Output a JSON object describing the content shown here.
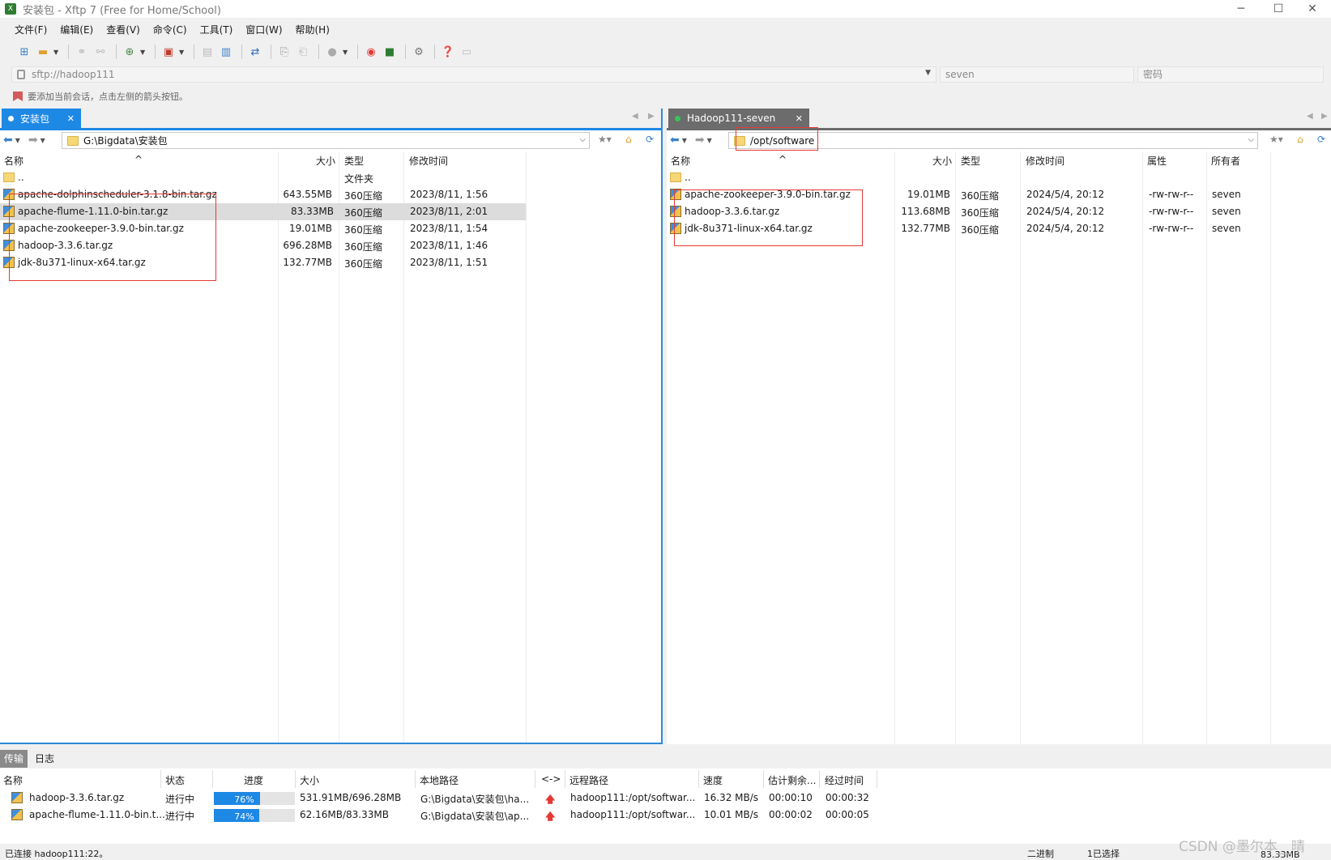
{
  "window": {
    "title": "安装包 - Xftp 7 (Free for Home/School)",
    "minimize": "─",
    "maximize": "☐",
    "close": "✕"
  },
  "menu": [
    "文件(F)",
    "编辑(E)",
    "查看(V)",
    "命令(C)",
    "工具(T)",
    "窗口(W)",
    "帮助(H)"
  ],
  "address": {
    "url": "sftp://hadoop111",
    "user_placeholder": "seven",
    "password_placeholder": "密码"
  },
  "hint": "要添加当前会话，点击左侧的箭头按钮。",
  "left": {
    "tab": "安装包",
    "path": "G:\\Bigdata\\安装包",
    "columns": [
      "名称",
      "大小",
      "类型",
      "修改时间"
    ],
    "parent": {
      "name": "..",
      "type": "文件夹"
    },
    "files": [
      {
        "name": "apache-dolphinscheduler-3.1.8-bin.tar.gz",
        "size": "643.55MB",
        "type": "360压缩",
        "mtime": "2023/8/11, 1:56"
      },
      {
        "name": "apache-flume-1.11.0-bin.tar.gz",
        "size": "83.33MB",
        "type": "360压缩",
        "mtime": "2023/8/11, 2:01"
      },
      {
        "name": "apache-zookeeper-3.9.0-bin.tar.gz",
        "size": "19.01MB",
        "type": "360压缩",
        "mtime": "2023/8/11, 1:54"
      },
      {
        "name": "hadoop-3.3.6.tar.gz",
        "size": "696.28MB",
        "type": "360压缩",
        "mtime": "2023/8/11, 1:46"
      },
      {
        "name": "jdk-8u371-linux-x64.tar.gz",
        "size": "132.77MB",
        "type": "360压缩",
        "mtime": "2023/8/11, 1:51"
      }
    ]
  },
  "right": {
    "tab": "Hadoop111-seven",
    "path": "/opt/software",
    "columns": [
      "名称",
      "大小",
      "类型",
      "修改时间",
      "属性",
      "所有者"
    ],
    "parent": {
      "name": ".."
    },
    "files": [
      {
        "name": "apache-zookeeper-3.9.0-bin.tar.gz",
        "size": "19.01MB",
        "type": "360压缩",
        "mtime": "2024/5/4, 20:12",
        "attr": "-rw-rw-r--",
        "owner": "seven"
      },
      {
        "name": "hadoop-3.3.6.tar.gz",
        "size": "113.68MB",
        "type": "360压缩",
        "mtime": "2024/5/4, 20:12",
        "attr": "-rw-rw-r--",
        "owner": "seven"
      },
      {
        "name": "jdk-8u371-linux-x64.tar.gz",
        "size": "132.77MB",
        "type": "360压缩",
        "mtime": "2024/5/4, 20:12",
        "attr": "-rw-rw-r--",
        "owner": "seven"
      }
    ]
  },
  "transfer": {
    "tabs": [
      "传输",
      "日志"
    ],
    "columns": [
      "名称",
      "状态",
      "进度",
      "大小",
      "本地路径",
      "<->",
      "远程路径",
      "速度",
      "估计剩余...",
      "经过时间"
    ],
    "rows": [
      {
        "name": "hadoop-3.3.6.tar.gz",
        "status": "进行中",
        "progress": "76%",
        "progress_fraction": 0.76,
        "size": "531.91MB/696.28MB",
        "local": "G:\\Bigdata\\安装包\\ha...",
        "remote": "hadoop111:/opt/softwar...",
        "speed": "16.32 MB/s",
        "eta": "00:00:10",
        "elapsed": "00:00:32"
      },
      {
        "name": "apache-flume-1.11.0-bin.t...",
        "status": "进行中",
        "progress": "74%",
        "progress_fraction": 0.74,
        "size": "62.16MB/83.33MB",
        "local": "G:\\Bigdata\\安装包\\ap...",
        "remote": "hadoop111:/opt/softwar...",
        "speed": "10.01 MB/s",
        "eta": "00:00:02",
        "elapsed": "00:00:05"
      }
    ]
  },
  "status": {
    "connection": "已连接 hadoop111:22。",
    "mode": "二进制",
    "selected": "1已选择",
    "size": "83.33MB"
  },
  "watermark": "CSDN @墨尔本__晴",
  "colors": {
    "accent": "#1e88e5",
    "highlight": "#e53935",
    "remote_tab": "#6c6c6c"
  }
}
